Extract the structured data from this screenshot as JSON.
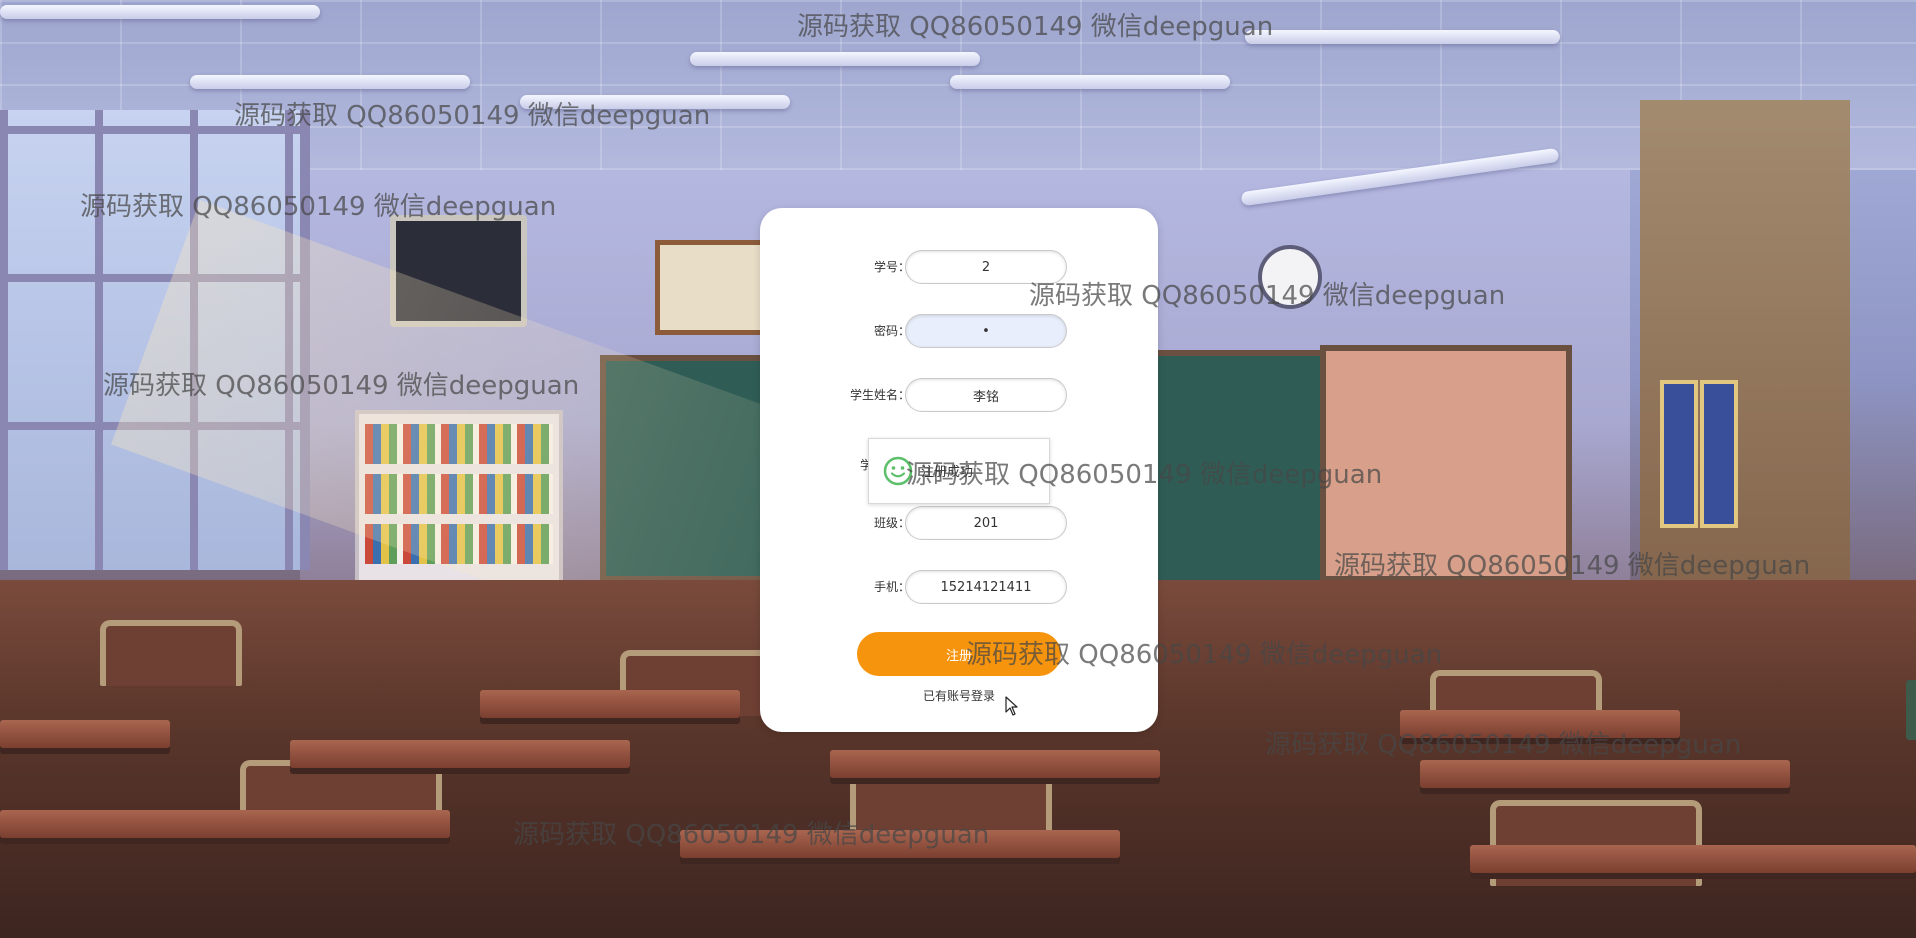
{
  "watermark_text": "源码获取 QQ86050149 微信deepguan",
  "form": {
    "student_id": {
      "label": "学号：",
      "value": "2"
    },
    "password": {
      "label": "密码：",
      "value": "•"
    },
    "student_name": {
      "label": "学生姓名：",
      "value": "李铭"
    },
    "class": {
      "label": "班级：",
      "value": "201"
    },
    "phone": {
      "label": "手机：",
      "value": "15214121411"
    },
    "register_button": "注册",
    "login_link": "已有账号登录"
  },
  "popup": {
    "message": "注册成功",
    "hidden_label": "学"
  },
  "colors": {
    "accent": "#f7940d",
    "card_background": "#ffffff",
    "popup_icon": "#5cbf6a"
  }
}
